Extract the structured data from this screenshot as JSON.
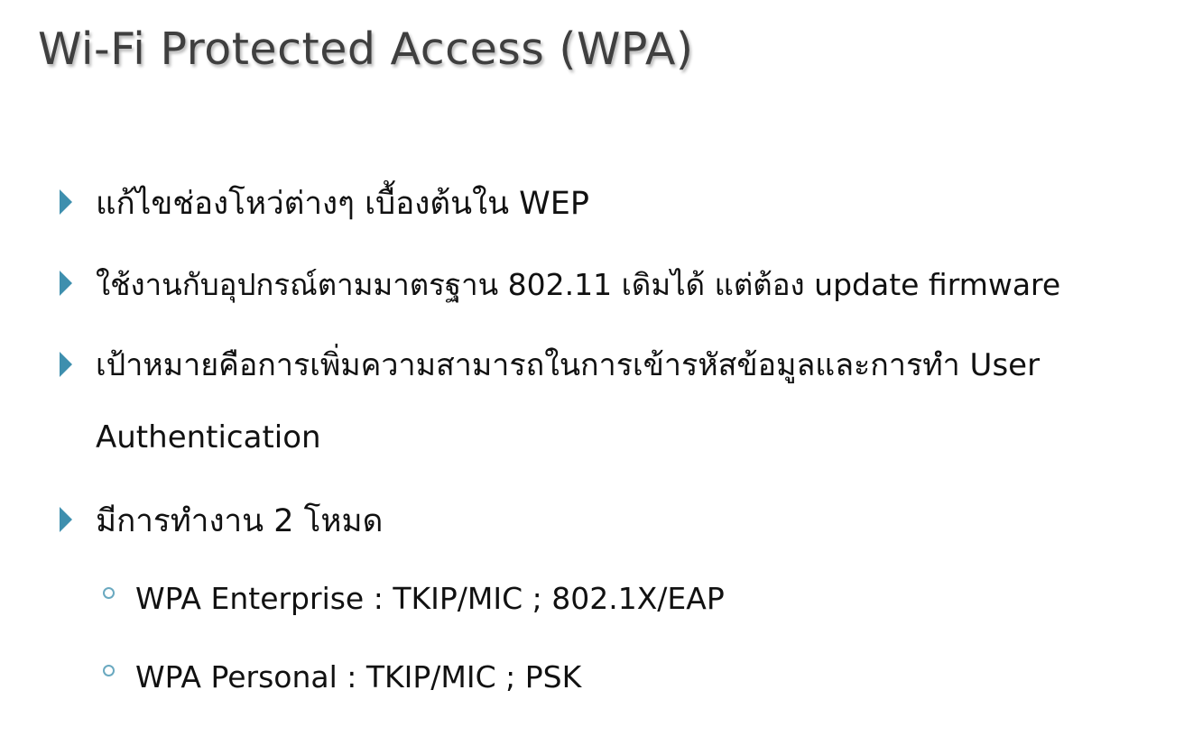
{
  "slide": {
    "title": "Wi-Fi Protected Access (WPA)",
    "bullets": [
      {
        "level": 1,
        "text": "แก้ไขช่องโหว่ต่างๆ เบื้องต้นใน WEP"
      },
      {
        "level": 1,
        "text": "ใช้งานกับอุปกรณ์ตามมาตรฐาน 802.11 เดิมได้ แต่ต้อง update firmware"
      },
      {
        "level": 1,
        "text": "เป้าหมายคือการเพิ่มความสามารถในการเข้ารหัสข้อมูลและการทำ User Authentication"
      },
      {
        "level": 1,
        "text": "มีการทำงาน 2 โหมด"
      },
      {
        "level": 2,
        "text": "WPA Enterprise : TKIP/MIC ; 802.1X/EAP"
      },
      {
        "level": 2,
        "text": "WPA Personal : TKIP/MIC ; PSK"
      }
    ],
    "colors": {
      "title": "#3f3f3f",
      "text": "#111111",
      "bullet_arrow": "#3e8fae",
      "bullet_ring": "#6aa9c0",
      "background": "#ffffff"
    },
    "icons": {
      "level1": "triangle-right-icon",
      "level2": "ring-icon"
    }
  }
}
